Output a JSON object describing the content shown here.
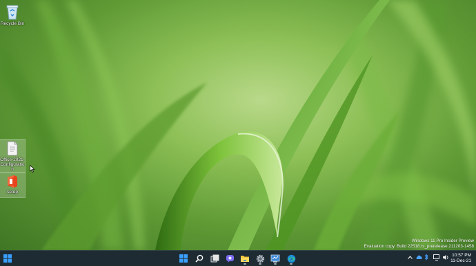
{
  "desktop": {
    "icons": [
      {
        "label": "Recycle Bin",
        "icon": "recycle-bin-icon"
      },
      {
        "label": "Office-2021-Configuratio n",
        "icon": "document-icon"
      },
      {
        "label": "setup",
        "icon": "office-icon"
      }
    ],
    "watermark": {
      "line1": "Windows 11 Pro Insider Preview",
      "line2": "Evaluation copy. Build 22518.rs_prerelease.211203-1458"
    }
  },
  "taskbar": {
    "pinned": [
      {
        "name": "start-button",
        "icon": "windows-logo-icon"
      },
      {
        "name": "search-button",
        "icon": "search-icon"
      },
      {
        "name": "task-view-button",
        "icon": "task-view-icon"
      },
      {
        "name": "chat-button",
        "icon": "chat-icon"
      },
      {
        "name": "file-explorer-button",
        "icon": "folder-icon"
      },
      {
        "name": "settings-button",
        "icon": "gear-icon"
      },
      {
        "name": "control-panel-button",
        "icon": "control-panel-icon"
      },
      {
        "name": "edge-button",
        "icon": "edge-icon"
      }
    ],
    "clock": {
      "time": "10:57 PM",
      "date": "11-Dec-21"
    }
  },
  "colors": {
    "taskbar": "#1e2b33",
    "accent": "#1e90ff",
    "grass_light": "#b9d98a",
    "grass_dark": "#3f7624"
  }
}
